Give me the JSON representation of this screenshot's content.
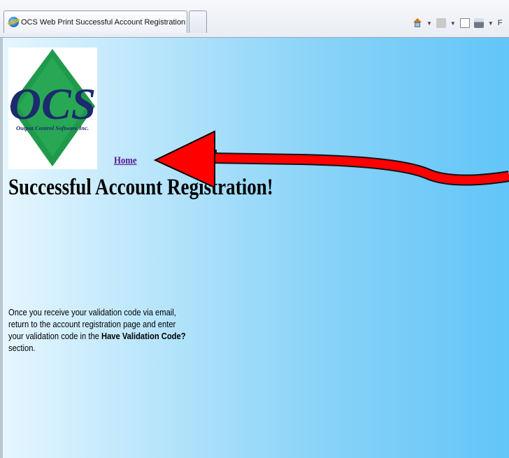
{
  "browser": {
    "tab_title": "OCS Web Print Successful Account Registration",
    "cmd_partial_label": "F",
    "icons": [
      "ie-icon",
      "home-icon",
      "feeds-icon",
      "mail-icon",
      "print-icon"
    ]
  },
  "logo": {
    "big_text": "OCS",
    "subtitle": "Output Control Software Inc.",
    "colors": {
      "diamond": "#1f9a4a",
      "letters": "#1c2a6e"
    }
  },
  "nav": {
    "home_label": "Home"
  },
  "main": {
    "title": "Successful Account Registration!",
    "message_before": "Once you receive your validation code via email, return to the account registration page and enter your validation code in the ",
    "message_bold": "Have Validation Code?",
    "message_after": " section."
  },
  "annotation": {
    "color": "#ff0000",
    "icon": "arrow-annotation"
  }
}
